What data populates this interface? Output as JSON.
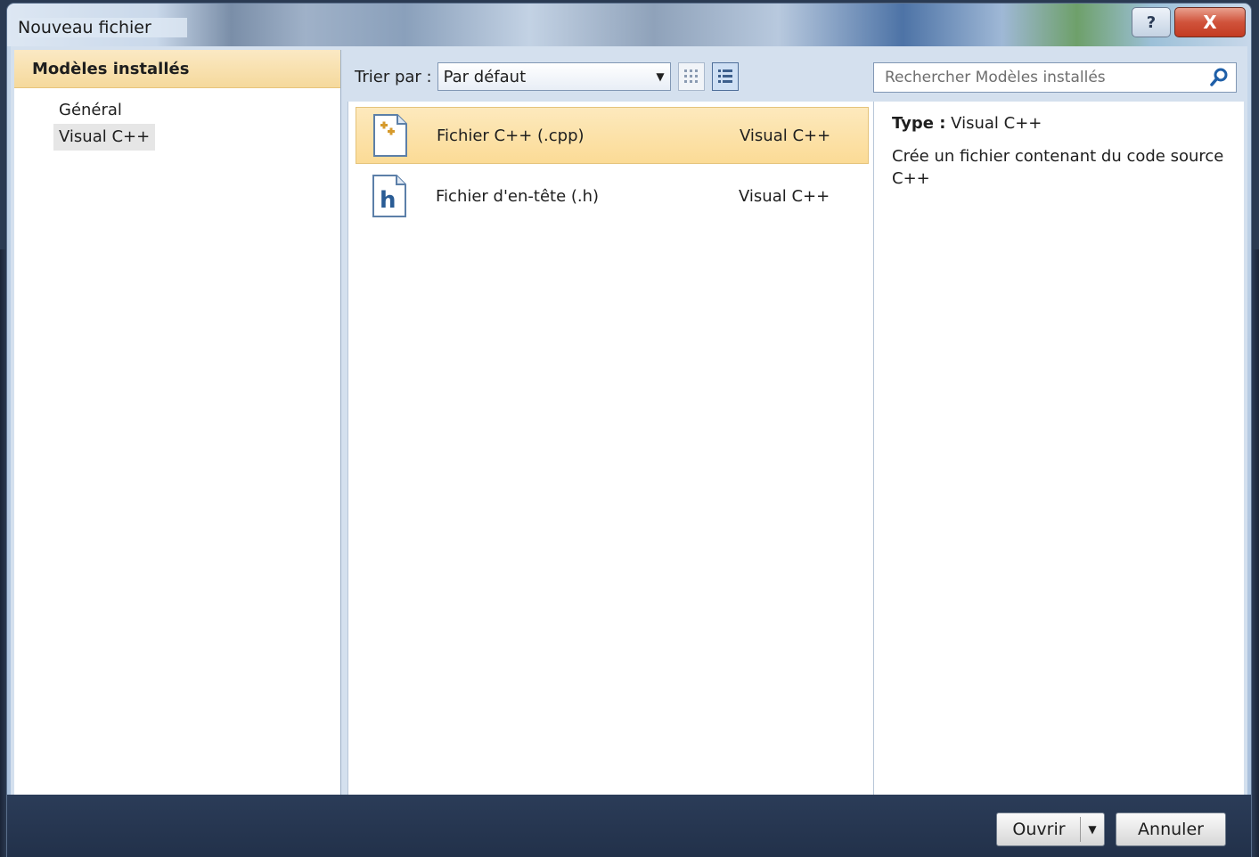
{
  "window": {
    "title": "Nouveau fichier",
    "help_label": "?",
    "close_label": "X"
  },
  "left_pane": {
    "header": "Modèles installés",
    "items": [
      {
        "label": "Général",
        "selected": false
      },
      {
        "label": "Visual C++",
        "selected": true
      }
    ]
  },
  "toolbar": {
    "sort_label": "Trier par :",
    "sort_value": "Par défaut",
    "view_modes": [
      "small-icons-view-icon",
      "list-view-icon"
    ],
    "active_view": "list-view-icon"
  },
  "search": {
    "placeholder": "Rechercher Modèles installés"
  },
  "templates": [
    {
      "name": "Fichier C++ (.cpp)",
      "language": "Visual C++",
      "icon": "cpp-file-icon",
      "selected": true
    },
    {
      "name": "Fichier d'en-tête (.h)",
      "language": "Visual C++",
      "icon": "header-file-icon",
      "selected": false
    }
  ],
  "details": {
    "type_label": "Type :",
    "type_value": "Visual C++",
    "description": "Crée un fichier contenant du code source C++"
  },
  "footer": {
    "open_label": "Ouvrir",
    "cancel_label": "Annuler"
  },
  "colors": {
    "selection": "#fbdb96",
    "footer": "#22314a",
    "close_button": "#c33b22"
  }
}
